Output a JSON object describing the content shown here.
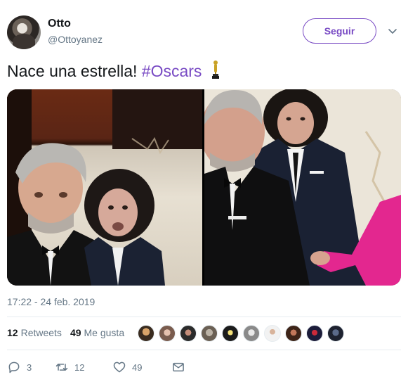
{
  "author": {
    "name": "Otto",
    "handle": "@Ottoyanez",
    "avatar_icon": "user-avatar"
  },
  "follow_button": {
    "label": "Seguir"
  },
  "more_icon": "chevron-down-icon",
  "tweet": {
    "text": "Nace una estrella! ",
    "hashtag": "#Oscars",
    "emoji_icon": "oscar-trophy-icon"
  },
  "media": [
    {
      "name": "photo-left"
    },
    {
      "name": "photo-right"
    }
  ],
  "timestamp": "17:22 - 24 feb. 2019",
  "stats": {
    "retweets_count": "12",
    "retweets_label": "Retweets",
    "likes_count": "49",
    "likes_label": "Me gusta"
  },
  "likers_count_shown": 10,
  "actions": {
    "reply_count": "3",
    "retweet_count": "12",
    "like_count": "49"
  },
  "colors": {
    "accent": "#794bc4",
    "muted": "#657786",
    "text": "#14171a",
    "divider": "#e6ecf0"
  }
}
